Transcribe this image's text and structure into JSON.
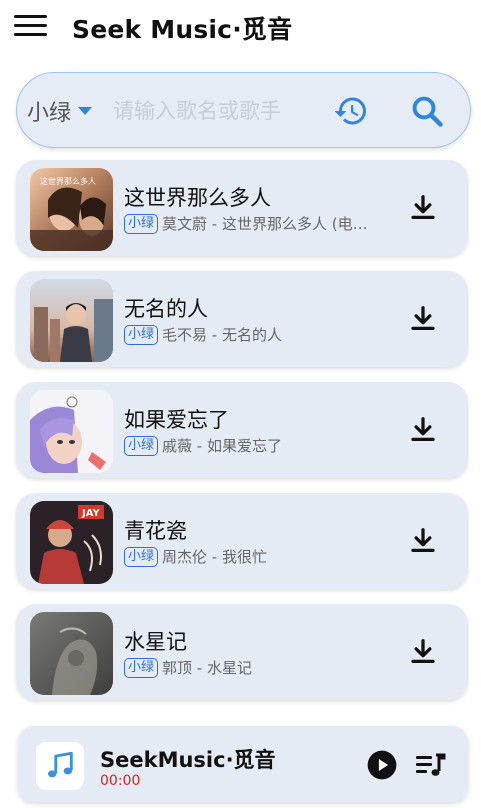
{
  "app_bar": {
    "title": "Seek Music·觅音",
    "menu_icon": "hamburger-menu-icon"
  },
  "search": {
    "source_selected": "小绿",
    "placeholder": "请输入歌名或歌手",
    "value": "",
    "history_icon": "history-icon",
    "search_icon": "search-icon",
    "accent_color": "#2f86dc"
  },
  "songs": [
    {
      "title": "这世界那么多人",
      "source": "小绿",
      "subtitle": "莫文蔚 - 这世界那么多人 (电影...",
      "action_icon": "download-icon"
    },
    {
      "title": "无名的人",
      "source": "小绿",
      "subtitle": "毛不易 - 无名的人",
      "action_icon": "download-icon"
    },
    {
      "title": "如果爱忘了",
      "source": "小绿",
      "subtitle": "戚薇 - 如果爱忘了",
      "action_icon": "download-icon"
    },
    {
      "title": "青花瓷",
      "source": "小绿",
      "subtitle": "周杰伦 - 我很忙",
      "action_icon": "download-icon"
    },
    {
      "title": "水星记",
      "source": "小绿",
      "subtitle": "郭顶 - 水星记",
      "action_icon": "download-icon"
    }
  ],
  "player": {
    "title": "SeekMusic·觅音",
    "time": "00:00",
    "art_icon": "music-note-icon",
    "play_icon": "play-icon",
    "queue_icon": "playlist-icon"
  }
}
